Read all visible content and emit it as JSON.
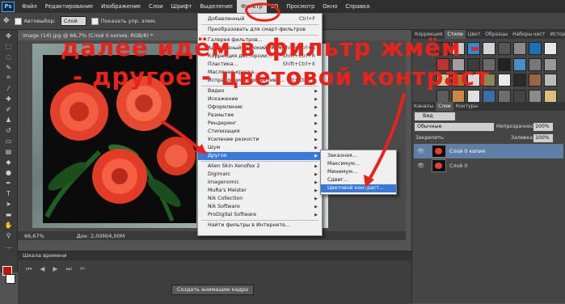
{
  "app": {
    "logo": "Ps"
  },
  "menubar": {
    "items": [
      "Файл",
      "Редактирование",
      "Изображение",
      "Слои",
      "Шрифт",
      "Выделение",
      "Фильтр",
      "3D",
      "Просмотр",
      "Окно",
      "Справка"
    ]
  },
  "options": {
    "autoselect_label": "Автовыбор:",
    "autoselect_value": "Слой",
    "show_transform": "Показать упр. элем."
  },
  "document": {
    "tab_title": "image (14).jpg @ 66,7% (Слой 0 копия, RGB/8) *",
    "zoom": "66,67%",
    "doc_info": "Док: 2,00M/4,00M"
  },
  "timeline": {
    "panel_title": "Шкала времени",
    "create_button": "Создать анимацию кадра"
  },
  "filter_menu": {
    "items": [
      {
        "label": "Добавленный",
        "shortcut": "Ctrl+F"
      },
      {
        "label": "Преобразовать для смарт-фильтров"
      },
      {
        "label": "Галерея фильтров..."
      },
      {
        "label": "Адаптивный широкий угол...",
        "shortcut": "Alt+Shift+Ctrl+A"
      },
      {
        "label": "Коррекция дисторсии...",
        "shortcut": "Shift+Ctrl+R"
      },
      {
        "label": "Пластика...",
        "shortcut": "Shift+Ctrl+X"
      },
      {
        "label": "Масляная краска..."
      },
      {
        "label": "Исправление перспективы...",
        "shortcut": "Alt+Ctrl+V"
      },
      {
        "label": "Видео",
        "sub": true
      },
      {
        "label": "Искажение",
        "sub": true
      },
      {
        "label": "Оформление",
        "sub": true
      },
      {
        "label": "Размытие",
        "sub": true
      },
      {
        "label": "Рендеринг",
        "sub": true
      },
      {
        "label": "Стилизация",
        "sub": true
      },
      {
        "label": "Усиление резкости",
        "sub": true
      },
      {
        "label": "Шум",
        "sub": true
      },
      {
        "label": "Другое",
        "sub": true,
        "highlight": true
      },
      {
        "label": "Alien Skin Xenofex 2",
        "sub": true
      },
      {
        "label": "Digimarc",
        "sub": true
      },
      {
        "label": "Imagenomic",
        "sub": true
      },
      {
        "label": "MuRa's Meister",
        "sub": true
      },
      {
        "label": "Nik Collection",
        "sub": true
      },
      {
        "label": "Nik Software",
        "sub": true
      },
      {
        "label": "ProDigital Software",
        "sub": true
      },
      {
        "label": "Найти фильтры в Интернете..."
      }
    ]
  },
  "submenu_other": {
    "items": [
      "Заказная...",
      "Максимум...",
      "Минимум...",
      "Сдвиг...",
      "Цветовой контраст..."
    ],
    "highlight_index": 4
  },
  "right_panel": {
    "top_tabs": [
      "Коррекция",
      "Стили",
      "Цвет",
      "Образцы",
      "Наборы кист",
      "История"
    ],
    "active_top_tab": "Стили",
    "layer_tabs": [
      "Каналы",
      "Слои",
      "Контуры"
    ],
    "active_layer_tab": "Слои",
    "kind_label": "Вид",
    "blend_mode": "Обычные",
    "opacity_label": "Непрозрачность:",
    "opacity_value": "100%",
    "lock_label": "Закрепить:",
    "fill_label": "Заливка:",
    "fill_value": "100%",
    "layers": [
      {
        "name": "Слой 0 копия",
        "selected": true
      },
      {
        "name": "Слой 0",
        "selected": false
      }
    ],
    "style_swatch_colors": [
      "#3a3a3a",
      "#c8c8c8",
      "#2e8ad4",
      "#d2d2d2",
      "#555",
      "#8a8a8a",
      "#1e6fb8",
      "#e8e8e8",
      "#b33",
      "#a0a0a0",
      "#3c3c3c",
      "#6a6a6a",
      "#222",
      "#4a8cc9",
      "#777",
      "#999",
      "#cc9",
      "#b07030",
      "#d8d8d8",
      "#885",
      "#eaeaea",
      "#2a2a2a",
      "#964",
      "#bbb",
      "#5c5c5c",
      "#c84",
      "#e0e0e0",
      "#3a6ea8",
      "#6d6d6d",
      "#444",
      "#8b8b8b",
      "#d9c07a"
    ]
  },
  "annotation": {
    "line1": "далее идём в фильтр жмём -",
    "line2": "- другое - цветовой контраст",
    "color": "#e8231b"
  }
}
